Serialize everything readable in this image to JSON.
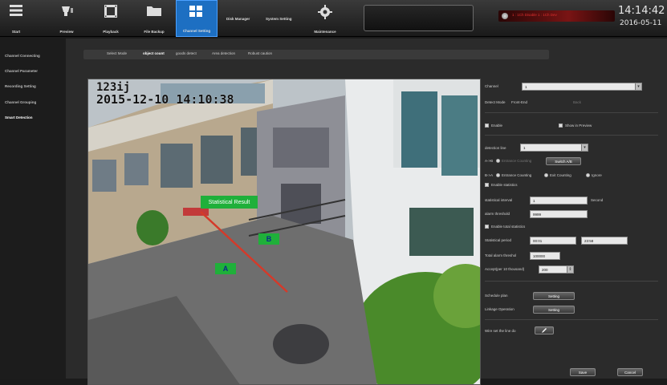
{
  "topbar": {
    "items": [
      {
        "label": "Start",
        "icon": "menu-list-icon"
      },
      {
        "label": "Preview",
        "icon": "camera-icon"
      },
      {
        "label": "Playback",
        "icon": "film-playback-icon"
      },
      {
        "label": "File Backup",
        "icon": "folder-icon"
      },
      {
        "label": "Channel Setting",
        "icon": "channel-grid-icon",
        "active": true
      }
    ],
    "disk_manager": "Disk Manager",
    "system_setting": "System Setting",
    "maintenance": "Maintenance",
    "status_text": "1 : 1Ch Disable 1 : 1Ch Dev",
    "clock_time": "14:14:42",
    "clock_date": "2016-05-11"
  },
  "sidebar": {
    "items": [
      {
        "label": "Channel Connecting"
      },
      {
        "label": "Channel Parameter"
      },
      {
        "label": "Recording Setting"
      },
      {
        "label": "Channel Grouping"
      },
      {
        "label": "Smart Detection",
        "active": true
      }
    ]
  },
  "tabs": [
    {
      "label": "Select Mode"
    },
    {
      "label": "object count",
      "active": true
    },
    {
      "label": "goods detect"
    },
    {
      "label": "Area detection"
    },
    {
      "label": "Robust caution"
    }
  ],
  "camera": {
    "osd_id": "123ij",
    "osd_datetime": "2015-12-10 14:10:38",
    "stat_result": "Statistical Result",
    "zone_a": "A",
    "zone_b": "B"
  },
  "settings": {
    "channel_label": "Channel",
    "channel_value": "1",
    "detect_mode_label": "Detect Mode",
    "detect_mode_value": "Front-End",
    "detect_mode_extra": "Back",
    "enable_label": "Enable",
    "show_in_preview_label": "Show in Preview",
    "detection_line_label": "detection line",
    "detection_line_value": "1",
    "a_b_label": "A->B",
    "a_b_option": "Entrance Counting",
    "switch_ab_label": "Switch A/B",
    "b_a_label": "B->A",
    "b_a_opt1": "Entrance Counting",
    "b_a_opt2": "Exit Counting",
    "b_a_opt3": "Ignore",
    "enable_statistics_label": "Enable statistics",
    "stat_interval_label": "statistical interval",
    "stat_interval_value": "1",
    "stat_interval_unit": "Second",
    "alarm_threshold_label": "alarm threshold",
    "alarm_threshold_value": "9999",
    "enable_total_label": "Enable total statistics",
    "stat_period_label": "Statistical period",
    "stat_period_start": "00:01",
    "stat_period_end": "23:58",
    "total_alarm_label": "Total alarm threshol",
    "total_alarm_value": "100000",
    "accept_label": "Accept(per 10 thousand)",
    "accept_value": "200",
    "schedule_label": "Schedule plan",
    "schedule_btn": "Setting",
    "linkage_label": "Linkage Operation",
    "linkage_btn": "Setting",
    "draw_line_label": "Wire set the line do"
  },
  "footer": {
    "save": "Save",
    "cancel": "Cancel"
  },
  "colors": {
    "accent_blue": "#1d6fc2",
    "zone_green": "#1fb03a",
    "count_line_red": "#d43a2a"
  }
}
